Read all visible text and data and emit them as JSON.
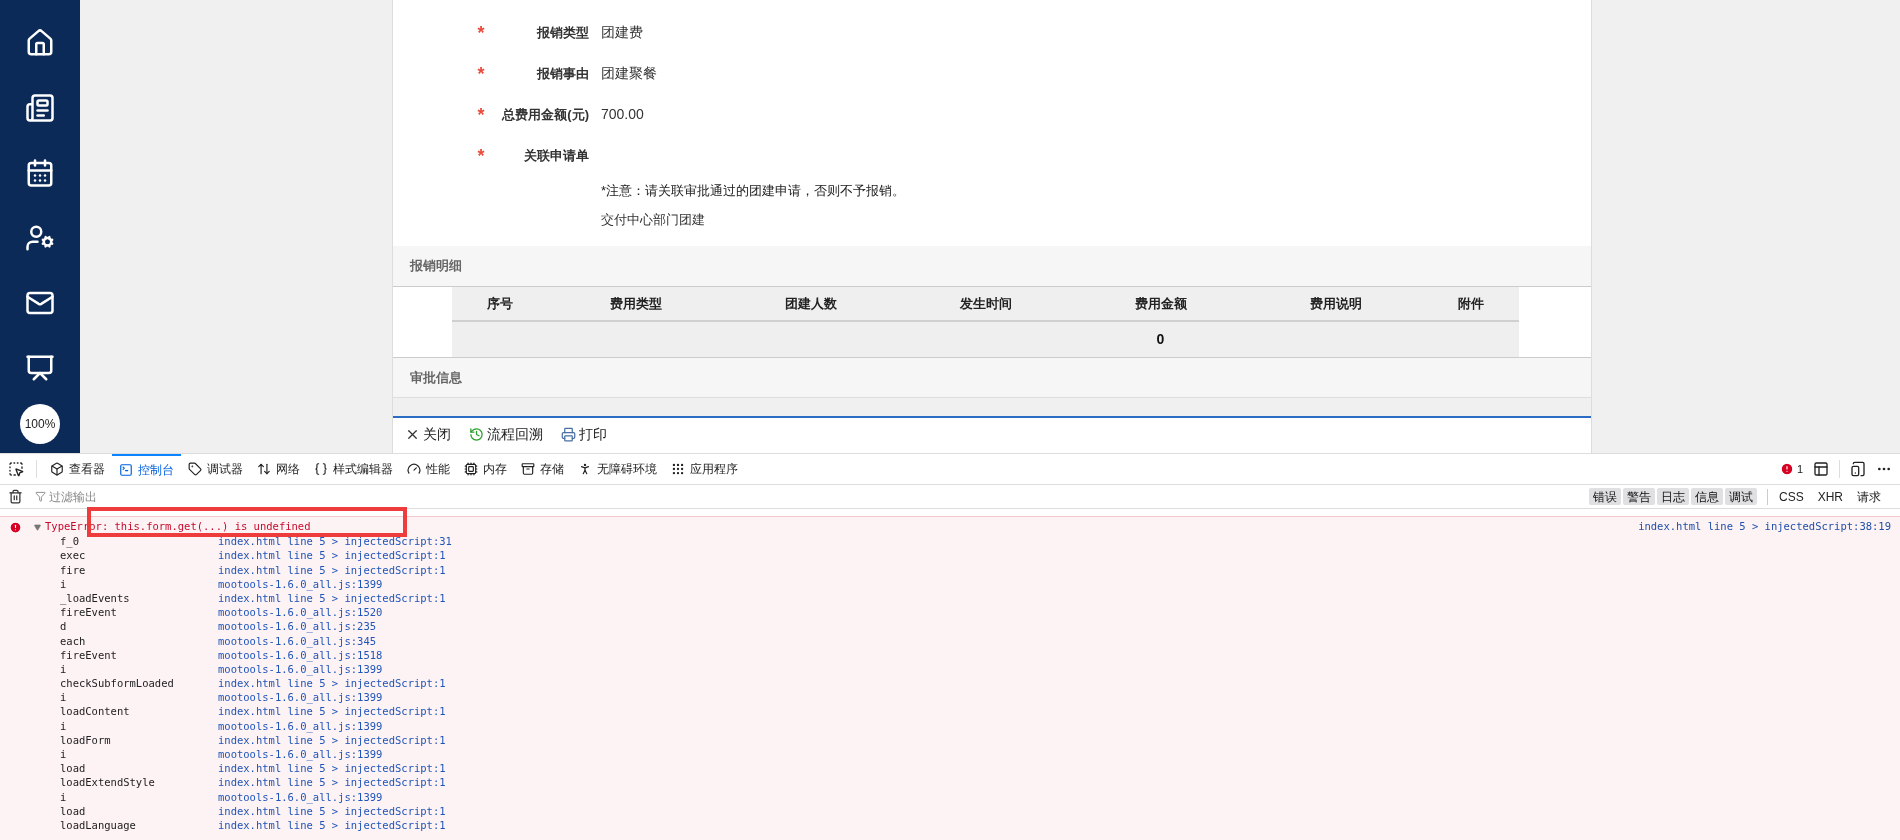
{
  "sidebar": {
    "zoom_badge": "100%"
  },
  "form": {
    "fields": [
      {
        "label": "报销类型",
        "value": "团建费",
        "required_mark": "*"
      },
      {
        "label": "报销事由",
        "value": "团建聚餐",
        "required_mark": "*"
      },
      {
        "label": "总费用金额(元)",
        "value": "700.00",
        "required_mark": "*"
      },
      {
        "label": "关联申请单",
        "required_mark": "*"
      }
    ],
    "note": "*注意：请关联审批通过的团建申请，否则不予报销。",
    "linked_item": "交付中心部门团建"
  },
  "detail_section": {
    "title": "报销明细",
    "table": {
      "columns": [
        "序号",
        "费用类型",
        "团建人数",
        "发生时间",
        "费用金额",
        "费用说明",
        "附件"
      ],
      "total_amount": "0"
    }
  },
  "approval_section": {
    "title": "审批信息"
  },
  "actions": [
    {
      "label": "关闭"
    },
    {
      "label": "流程回溯"
    },
    {
      "label": "打印"
    }
  ],
  "devtools": {
    "tabs": [
      {
        "label": "查看器",
        "selected": false
      },
      {
        "label": "控制台",
        "selected": true
      },
      {
        "label": "调试器",
        "selected": false
      },
      {
        "label": "网络",
        "selected": false
      },
      {
        "label": "样式编辑器",
        "selected": false
      },
      {
        "label": "性能",
        "selected": false
      },
      {
        "label": "内存",
        "selected": false
      },
      {
        "label": "存储",
        "selected": false
      },
      {
        "label": "无障碍环境",
        "selected": false
      },
      {
        "label": "应用程序",
        "selected": false
      }
    ],
    "error_count": "1",
    "filter": {
      "placeholder": "过滤输出"
    },
    "level_filters": [
      {
        "label": "错误",
        "selected": true
      },
      {
        "label": "警告",
        "selected": true
      },
      {
        "label": "日志",
        "selected": true
      },
      {
        "label": "信息",
        "selected": true
      },
      {
        "label": "调试",
        "selected": true
      }
    ],
    "type_filters": [
      {
        "label": "CSS",
        "selected": false
      },
      {
        "label": "XHR",
        "selected": false
      },
      {
        "label": "请求",
        "selected": false
      }
    ],
    "error": {
      "message": "TypeError: this.form.get(...) is undefined",
      "location": "index.html line 5 > injectedScript:38:19",
      "highlighted": true,
      "expanded": true,
      "stack": [
        {
          "fn": "f_0",
          "location": "index.html line 5 > injectedScript:31"
        },
        {
          "fn": "exec",
          "location": "index.html line 5 > injectedScript:1"
        },
        {
          "fn": "fire",
          "location": "index.html line 5 > injectedScript:1"
        },
        {
          "fn": "i",
          "location": "mootools-1.6.0_all.js:1399"
        },
        {
          "fn": "_loadEvents",
          "location": "index.html line 5 > injectedScript:1"
        },
        {
          "fn": "fireEvent",
          "location": "mootools-1.6.0_all.js:1520"
        },
        {
          "fn": "d",
          "location": "mootools-1.6.0_all.js:235"
        },
        {
          "fn": "each",
          "location": "mootools-1.6.0_all.js:345"
        },
        {
          "fn": "fireEvent",
          "location": "mootools-1.6.0_all.js:1518"
        },
        {
          "fn": "i",
          "location": "mootools-1.6.0_all.js:1399"
        },
        {
          "fn": "checkSubformLoaded",
          "location": "index.html line 5 > injectedScript:1"
        },
        {
          "fn": "i",
          "location": "mootools-1.6.0_all.js:1399"
        },
        {
          "fn": "loadContent",
          "location": "index.html line 5 > injectedScript:1"
        },
        {
          "fn": "i",
          "location": "mootools-1.6.0_all.js:1399"
        },
        {
          "fn": "loadForm",
          "location": "index.html line 5 > injectedScript:1"
        },
        {
          "fn": "i",
          "location": "mootools-1.6.0_all.js:1399"
        },
        {
          "fn": "load",
          "location": "index.html line 5 > injectedScript:1"
        },
        {
          "fn": "loadExtendStyle",
          "location": "index.html line 5 > injectedScript:1"
        },
        {
          "fn": "i",
          "location": "mootools-1.6.0_all.js:1399"
        },
        {
          "fn": "load",
          "location": "index.html line 5 > injectedScript:1"
        },
        {
          "fn": "loadLanguage",
          "location": "index.html line 5 > injectedScript:1"
        }
      ]
    }
  }
}
